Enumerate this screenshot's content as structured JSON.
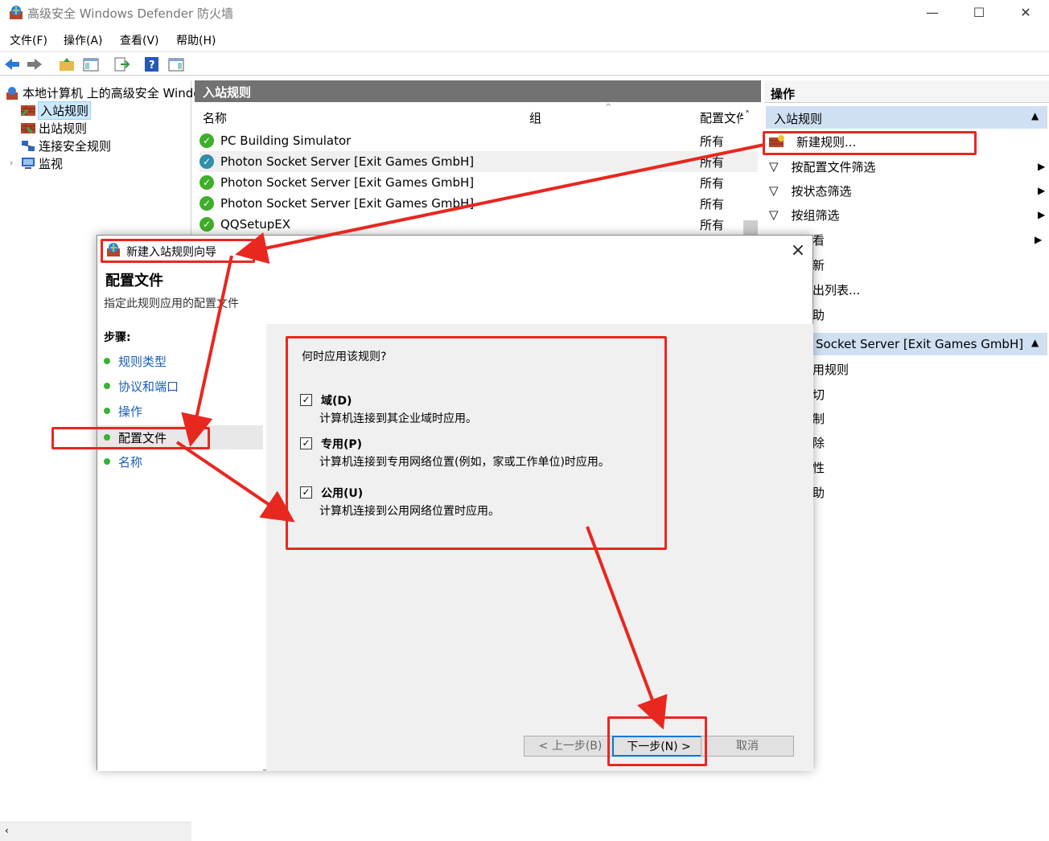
{
  "window": {
    "title": "高级安全 Windows Defender 防火墙",
    "min_icon": "minimize-icon",
    "max_icon": "maximize-icon",
    "close_icon": "close-icon"
  },
  "menu": [
    "文件(F)",
    "操作(A)",
    "查看(V)",
    "帮助(H)"
  ],
  "tree": {
    "root": "本地计算机 上的高级安全 Windows Defender 防火墙",
    "items": [
      "入站规则",
      "出站规则",
      "连接安全规则",
      "监视"
    ]
  },
  "middle": {
    "header": "入站规则",
    "columns": [
      "名称",
      "组",
      "配置文件"
    ],
    "rows": [
      {
        "name": "PC Building Simulator",
        "profile": "所有"
      },
      {
        "name": "Photon Socket Server [Exit Games GmbH]",
        "profile": "所有"
      },
      {
        "name": "Photon Socket Server [Exit Games GmbH]",
        "profile": "所有"
      },
      {
        "name": "Photon Socket Server [Exit Games GmbH]",
        "profile": "所有"
      },
      {
        "name": "QQSetupEX",
        "profile": "所有"
      }
    ]
  },
  "actions": {
    "title": "操作",
    "section1": "入站规则",
    "items1": [
      "新建规则...",
      "按配置文件筛选",
      "按状态筛选",
      "按组筛选",
      "看",
      "新",
      "出列表...",
      "助"
    ],
    "section2": "Socket Server [Exit Games GmbH]",
    "items2": [
      "用规则",
      "切",
      "制",
      "除",
      "性",
      "助"
    ]
  },
  "dialog": {
    "title": "新建入站规则向导",
    "heading": "配置文件",
    "subtitle": "指定此规则应用的配置文件",
    "steps_title": "步骤:",
    "steps": [
      "规则类型",
      "协议和端口",
      "操作",
      "配置文件",
      "名称"
    ],
    "question": "何时应用该规则?",
    "options": [
      {
        "title": "域(D)",
        "desc": "计算机连接到其企业域时应用。",
        "checked": true
      },
      {
        "title": "专用(P)",
        "desc": "计算机连接到专用网络位置(例如，家或工作单位)时应用。",
        "checked": true
      },
      {
        "title": "公用(U)",
        "desc": "计算机连接到公用网络位置时应用。",
        "checked": true
      }
    ],
    "buttons": {
      "back": "< 上一步(B)",
      "next": "下一步(N) >",
      "cancel": "取消"
    }
  },
  "colors": {
    "annotation": "#e8271f",
    "selection": "#cce8ff",
    "header_bg": "#727272",
    "section_bg": "#cfe0f3"
  }
}
